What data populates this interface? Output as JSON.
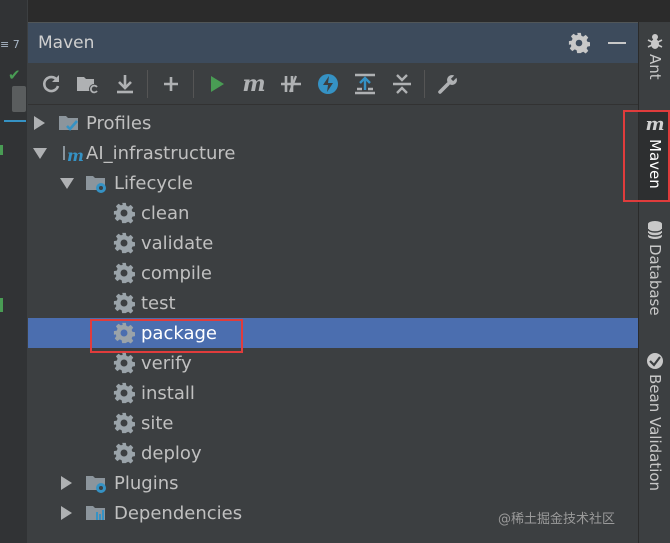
{
  "gutter": {
    "line_info": "≡ 7"
  },
  "panel": {
    "title": "Maven"
  },
  "toolbar": {
    "items": [
      "reload-icon",
      "add-folder-icon",
      "download-icon",
      "plus-icon",
      "run-icon",
      "maven-goal-icon",
      "toggle-offline-icon",
      "skip-tests-icon",
      "show-dependencies-icon",
      "collapse-all-icon",
      "settings-wrench-icon"
    ],
    "m_label": "m"
  },
  "tree": {
    "profiles": "Profiles",
    "project": "AI_infrastructure",
    "lifecycle": "Lifecycle",
    "goals": [
      "clean",
      "validate",
      "compile",
      "test",
      "package",
      "verify",
      "install",
      "site",
      "deploy"
    ],
    "selected_goal": "package",
    "plugins": "Plugins",
    "dependencies": "Dependencies"
  },
  "sidebar": {
    "tabs": [
      {
        "label": "Ant"
      },
      {
        "label": "Maven",
        "active": true
      },
      {
        "label": "Database"
      },
      {
        "label": "Bean Validation"
      }
    ],
    "maven_glyph": "m"
  },
  "watermark": "@稀土掘金技术社区",
  "colors": {
    "selection": "#4b6eaf",
    "header": "#3d4b5c",
    "highlight_box": "#e03c3c",
    "run_green": "#499c54",
    "accent_blue": "#3592c4"
  }
}
